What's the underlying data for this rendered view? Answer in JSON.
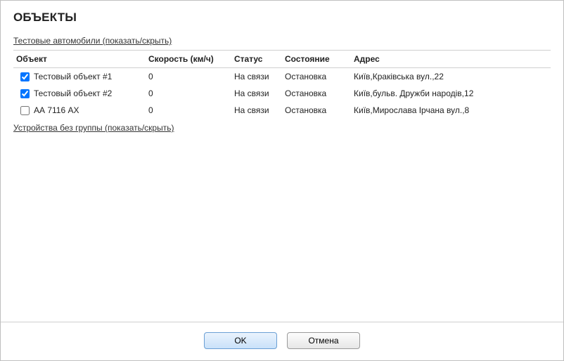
{
  "title": "ОБЪЕКТЫ",
  "groups": {
    "test": "Тестовые автомобили (показать/скрыть)",
    "nogroup": "Устройства без группы (показать/скрыть)"
  },
  "columns": {
    "object": "Объект",
    "speed": "Скорость (км/ч)",
    "status": "Статус",
    "state": "Состояние",
    "address": "Адрес"
  },
  "rows": [
    {
      "checked": true,
      "name": "Тестовый объект #1",
      "speed": "0",
      "status": "На связи",
      "state": "Остановка",
      "address": "Київ,Краківська вул.,22"
    },
    {
      "checked": true,
      "name": "Тестовый объект #2",
      "speed": "0",
      "status": "На связи",
      "state": "Остановка",
      "address": "Київ,бульв. Дружби народів,12"
    },
    {
      "checked": false,
      "name": "АА 7116 АХ",
      "speed": "0",
      "status": "На связи",
      "state": "Остановка",
      "address": "Київ,Мирослава Ірчана вул.,8"
    }
  ],
  "buttons": {
    "ok": "OK",
    "cancel": "Отмена"
  }
}
